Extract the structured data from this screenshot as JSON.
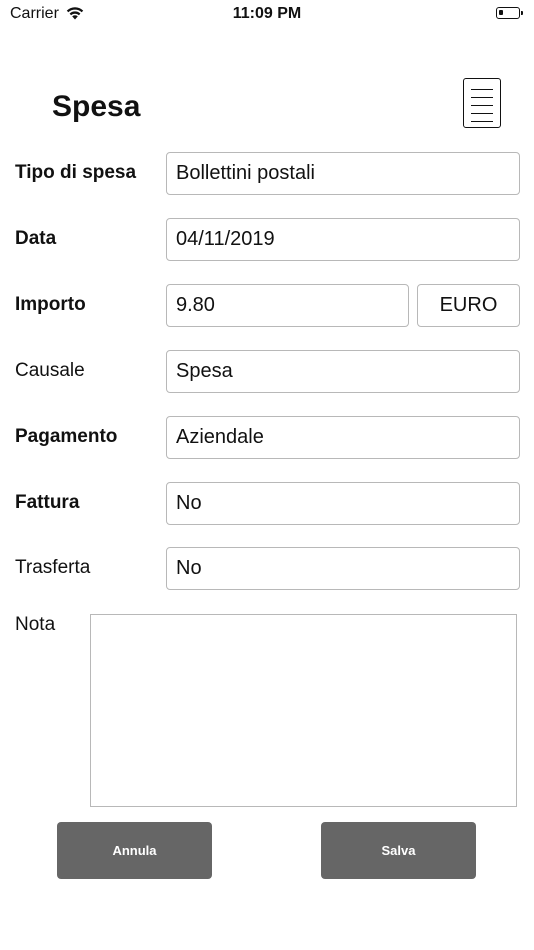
{
  "status_bar": {
    "carrier": "Carrier",
    "time": "11:09 PM",
    "wifi_icon": "wifi-icon",
    "battery_icon": "battery-low-icon",
    "battery_level": 0.15
  },
  "header": {
    "title": "Spesa",
    "menu_icon": "document-lines-icon"
  },
  "form": {
    "tipo_label": "Tipo di spesa",
    "tipo_value": "Bollettini postali",
    "data_label": "Data",
    "data_value": "04/11/2019",
    "importo_label": "Importo",
    "importo_value": "9.80",
    "currency_value": "EURO",
    "causale_label": "Causale",
    "causale_value": "Spesa",
    "pagamento_label": "Pagamento",
    "pagamento_value": "Aziendale",
    "fattura_label": "Fattura",
    "fattura_value": "No",
    "trasferta_label": "Trasferta",
    "trasferta_value": "No",
    "nota_label": "Nota",
    "nota_value": ""
  },
  "buttons": {
    "cancel_label": "Annula",
    "save_label": "Salva"
  },
  "colors": {
    "button_bg": "#666666",
    "button_text": "#ffffff",
    "field_border": "#b8b8b8"
  }
}
